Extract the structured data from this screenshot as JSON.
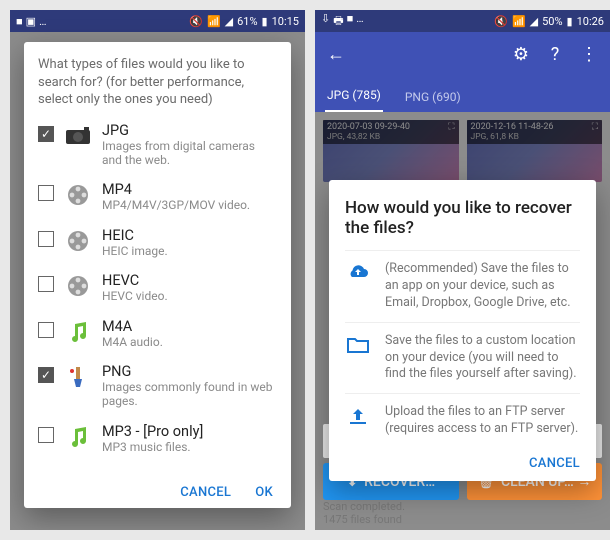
{
  "left": {
    "status": {
      "battery": "61%",
      "time": "10:15"
    },
    "dialog": {
      "prompt": "What types of files would you like to search for? (for better performance, select only the ones you need)",
      "items": [
        {
          "title": "JPG",
          "desc": "Images from digital cameras and the web.",
          "checked": true
        },
        {
          "title": "MP4",
          "desc": "MP4/M4V/3GP/MOV video.",
          "checked": false
        },
        {
          "title": "HEIC",
          "desc": "HEIC image.",
          "checked": false
        },
        {
          "title": "HEVC",
          "desc": "HEVC video.",
          "checked": false
        },
        {
          "title": "M4A",
          "desc": "M4A audio.",
          "checked": false
        },
        {
          "title": "PNG",
          "desc": "Images commonly found in web pages.",
          "checked": true
        },
        {
          "title": "MP3 - [Pro only]",
          "desc": "MP3 music files.",
          "checked": false
        }
      ],
      "cancel": "CANCEL",
      "ok": "OK"
    }
  },
  "right": {
    "status": {
      "battery": "50%",
      "time": "10:26"
    },
    "tabs": [
      {
        "label": "JPG (785)",
        "active": true
      },
      {
        "label": "PNG (690)",
        "active": false
      }
    ],
    "thumbs": [
      {
        "name": "2020-07-03 09-29-40",
        "size": "JPG, 43,82 KB"
      },
      {
        "name": "2020-12-16 11-48-26",
        "size": "JPG, 61,8 KB"
      }
    ],
    "dialog": {
      "title": "How would you like to recover the files?",
      "options": [
        {
          "desc": "(Recommended) Save the files to an app on your device, such as Email, Dropbox, Google Drive, etc.",
          "icon": "cloud-upload"
        },
        {
          "desc": "Save the files to a custom location on your device (you will need to find the files yourself after saving).",
          "icon": "folder"
        },
        {
          "desc": "Upload the files to an FTP server (requires access to an FTP server).",
          "icon": "upload"
        }
      ],
      "cancel": "CANCEL"
    },
    "buttons": {
      "recover": "RECOVER…",
      "cleanup": "CLEAN UP… →"
    },
    "scan": {
      "line1": "Scan completed.",
      "line2": "1475 files found"
    }
  }
}
